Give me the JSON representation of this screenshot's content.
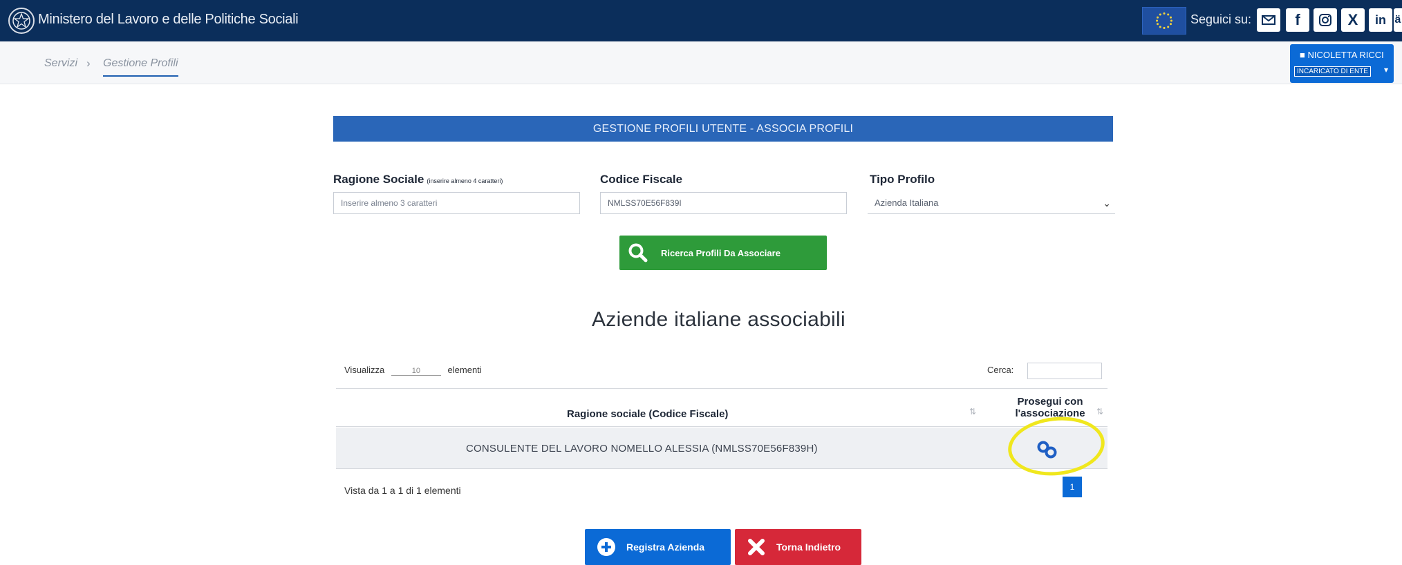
{
  "header": {
    "ministry": "Ministero del Lavoro e delle Politiche Sociali",
    "follow_label": "Seguici su:",
    "social": [
      {
        "icon": "mail-icon"
      },
      {
        "icon": "facebook-icon",
        "glyph": "f"
      },
      {
        "icon": "instagram-icon"
      },
      {
        "icon": "x-icon",
        "glyph": "X"
      },
      {
        "icon": "linkedin-icon",
        "glyph": "in"
      },
      {
        "icon": "extra-icon",
        "glyph": "ä"
      }
    ]
  },
  "breadcrumb": {
    "home": "Servizi",
    "separator": "›",
    "current": "Gestione Profili"
  },
  "user": {
    "name": "NICOLETTA RICCI",
    "role": "INCARICATO DI ENTE",
    "caret": "▾"
  },
  "panel": {
    "title": "GESTIONE PROFILI UTENTE - ASSOCIA PROFILI"
  },
  "form": {
    "ragione_label": "Ragione Sociale",
    "ragione_hint": "(inserire almeno 4 caratteri)",
    "ragione_placeholder": "Inserire almeno 3 caratteri",
    "cf_label": "Codice Fiscale",
    "cf_value": "NMLSS70E56F839I",
    "tipo_label": "Tipo Profilo",
    "tipo_value": "Azienda Italiana",
    "search_button": "Ricerca Profili Da Associare"
  },
  "results": {
    "title": "Aziende italiane associabili",
    "show_prefix": "Visualizza",
    "show_value": "10",
    "show_suffix": "elementi",
    "search_label": "Cerca:",
    "columns": [
      "Ragione sociale (Codice Fiscale)",
      "Prosegui con l'associazione"
    ],
    "sort_glyph": "⇅",
    "rows": [
      {
        "ragione": "CONSULENTE DEL LAVORO NOMELLO ALESSIA (NMLSS70E56F839H)"
      }
    ],
    "info": "Vista da 1 a 1 di 1 elementi",
    "page": "1"
  },
  "actions": {
    "register": "Registra Azienda",
    "back": "Torna Indietro"
  },
  "colors": {
    "topbar": "#0b2e5b",
    "primary": "#0b6ad6",
    "success": "#2e9b3a",
    "danger": "#d62839",
    "highlight": "#f0e71d"
  }
}
